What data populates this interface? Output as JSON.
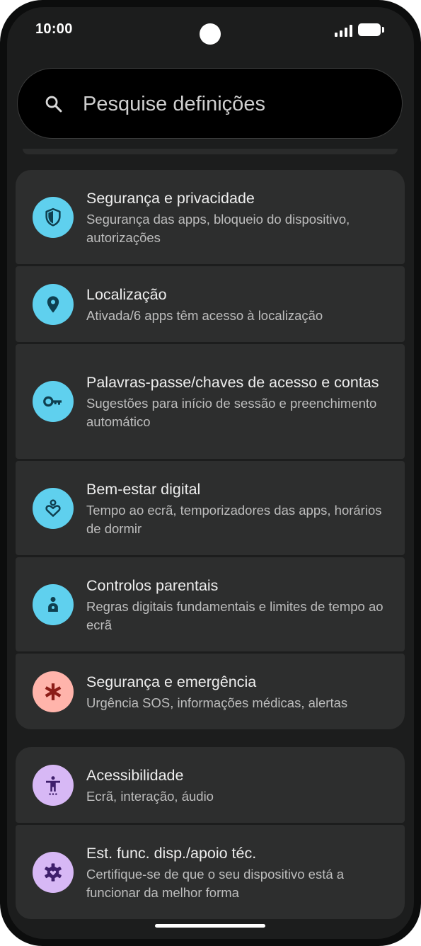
{
  "status_bar": {
    "time": "10:00"
  },
  "search": {
    "placeholder": "Pesquise definições"
  },
  "groups": [
    {
      "items": [
        {
          "title": "Segurança e privacidade",
          "subtitle": "Segurança das apps, bloqueio do dispositivo, autorizações",
          "icon": "shield-icon",
          "icon_bg": "#5fd0ee",
          "icon_color": "#0f3f4f"
        },
        {
          "title": "Localização",
          "subtitle": "Ativada/6 apps têm acesso à localização",
          "icon": "location-pin-icon",
          "icon_bg": "#5fd0ee",
          "icon_color": "#0f3f4f"
        },
        {
          "title": "Palavras-passe/chaves de acesso e contas",
          "subtitle": "Sugestões para início de sessão e preenchimento automático",
          "icon": "key-icon",
          "icon_bg": "#5fd0ee",
          "icon_color": "#0f3f4f"
        },
        {
          "title": "Bem-estar digital",
          "subtitle": "Tempo ao ecrã, temporizadores das apps, horários de dormir",
          "icon": "wellbeing-heart-icon",
          "icon_bg": "#5fd0ee",
          "icon_color": "#0f3f4f"
        },
        {
          "title": "Controlos parentais",
          "subtitle": "Regras digitais fundamentais e limites de tempo ao ecrã",
          "icon": "parental-child-icon",
          "icon_bg": "#5fd0ee",
          "icon_color": "#0f3f4f"
        },
        {
          "title": "Segurança e emergência",
          "subtitle": "Urgência SOS, informações médicas, alertas",
          "icon": "medical-asterisk-icon",
          "icon_bg": "#ffb4ab",
          "icon_color": "#8c1d18"
        }
      ]
    },
    {
      "items": [
        {
          "title": "Acessibilidade",
          "subtitle": "Ecrã, interação, áudio",
          "icon": "accessibility-icon",
          "icon_bg": "#d7b8f5",
          "icon_color": "#3e1f6b"
        },
        {
          "title": "Est. func. disp./apoio téc.",
          "subtitle": "Certifique-se de que o seu dispositivo está a funcionar da melhor forma",
          "icon": "device-care-gear-icon",
          "icon_bg": "#d7b8f5",
          "icon_color": "#3e1f6b"
        }
      ]
    }
  ]
}
